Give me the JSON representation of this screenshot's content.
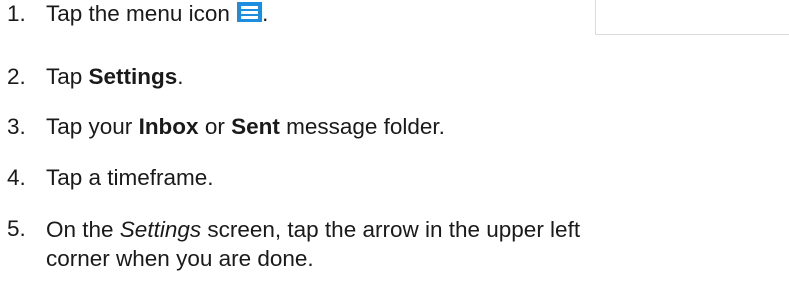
{
  "steps": [
    {
      "number": "1.",
      "text_before": "Tap the menu icon ",
      "icon": "menu-icon",
      "text_after": "."
    },
    {
      "number": "2.",
      "text_before": "Tap ",
      "bold": "Settings",
      "text_after": "."
    },
    {
      "number": "3.",
      "text_before": "Tap your ",
      "bold_1": "Inbox",
      "text_mid": " or ",
      "bold_2": "Sent",
      "text_after": " message folder."
    },
    {
      "number": "4.",
      "text": "Tap a timeframe."
    },
    {
      "number": "5.",
      "text_before": "On the ",
      "italic": "Settings",
      "text_line1_after": " screen, tap the arrow in the upper left",
      "text_line2": "corner when you are done."
    }
  ],
  "colors": {
    "icon_blue": "#1d8de0",
    "text": "#1a1a1a"
  }
}
